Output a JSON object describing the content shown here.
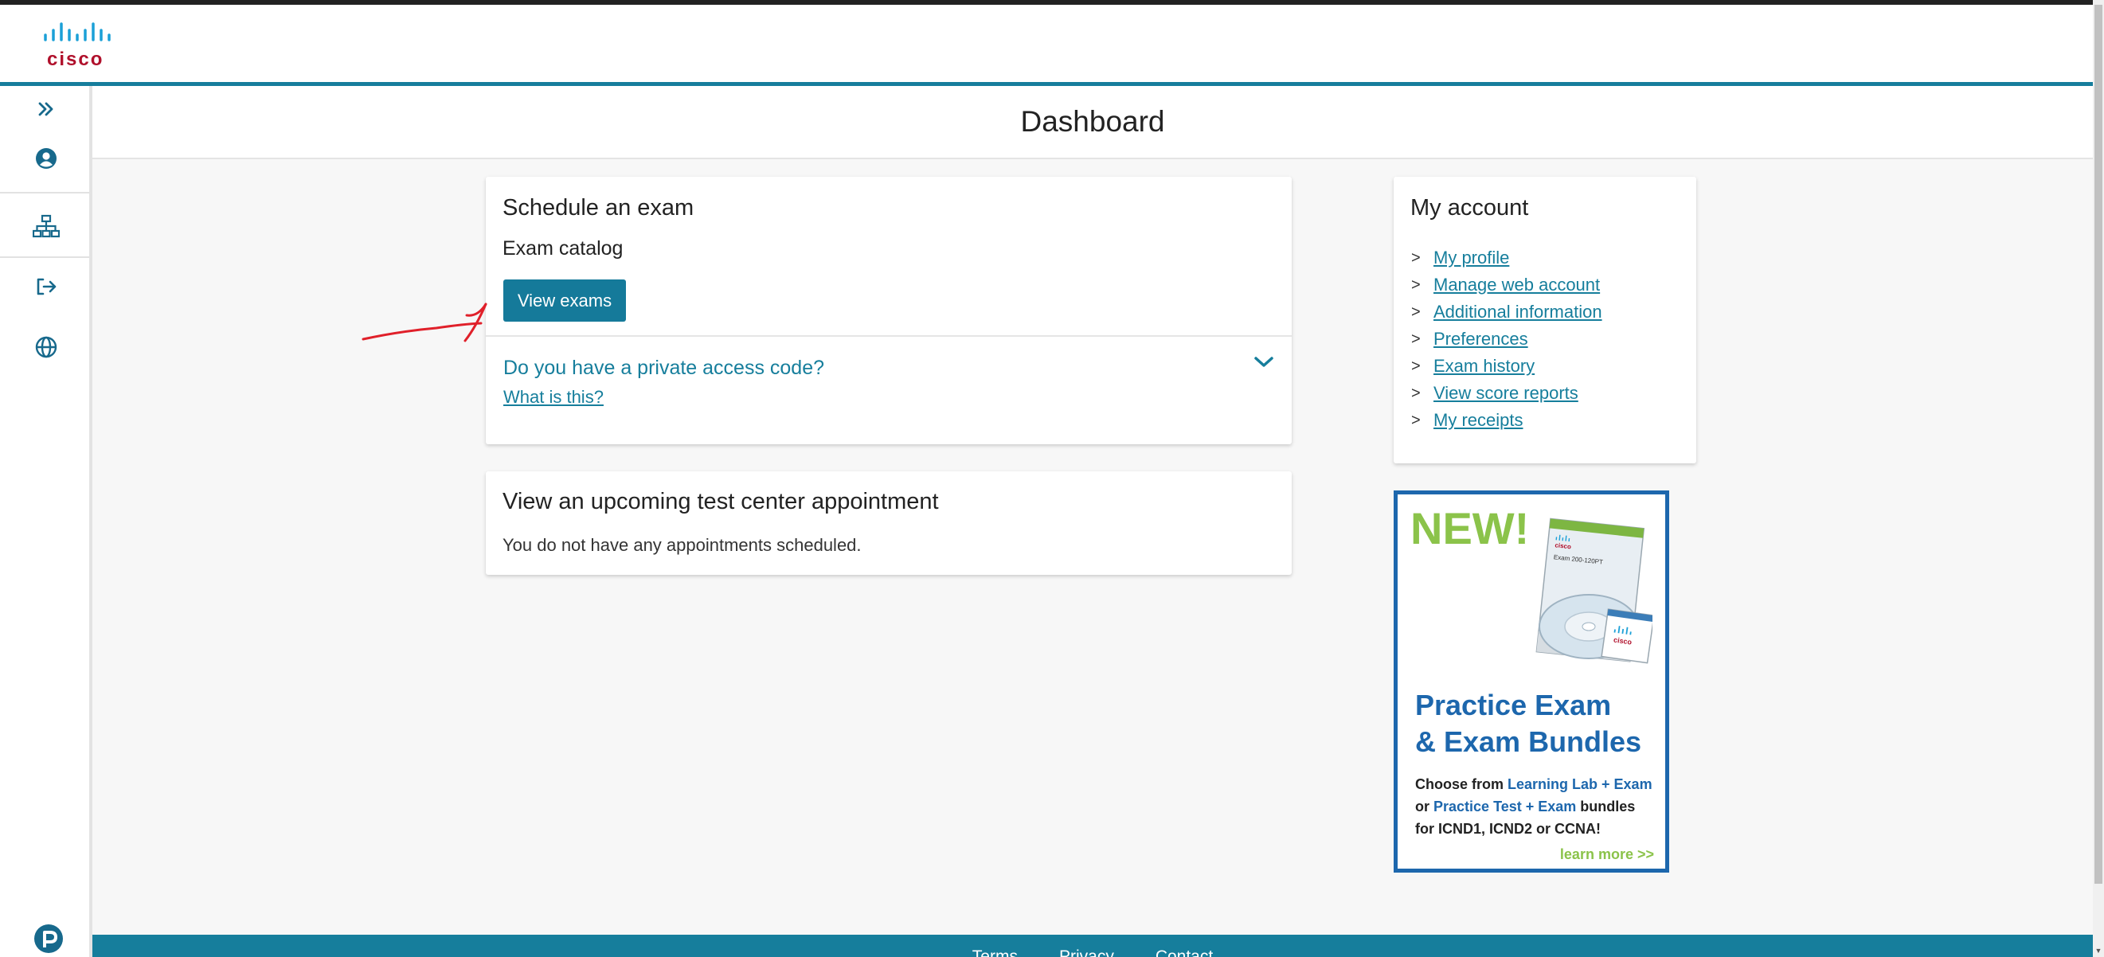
{
  "header": {
    "logo_text": "cisco"
  },
  "sidebar": {
    "items": [
      {
        "name": "expand",
        "icon": "double-chevron-right-icon"
      },
      {
        "name": "account",
        "icon": "user-circle-icon"
      },
      {
        "name": "org-chart",
        "icon": "sitemap-icon"
      },
      {
        "name": "sign-out",
        "icon": "sign-out-icon"
      },
      {
        "name": "language",
        "icon": "globe-icon"
      }
    ],
    "bottom_icon": "pearson-logo-icon"
  },
  "page": {
    "title": "Dashboard"
  },
  "schedule": {
    "heading": "Schedule an exam",
    "subheading": "Exam catalog",
    "button_label": "View exams",
    "access_question": "Do you have a private access code?",
    "what_link": "What is this?"
  },
  "appointments": {
    "heading": "View an upcoming test center appointment",
    "message": "You do not have any appointments scheduled."
  },
  "account": {
    "heading": "My account",
    "links": [
      {
        "label": "My profile"
      },
      {
        "label": "Manage web account"
      },
      {
        "label": "Additional information"
      },
      {
        "label": "Preferences"
      },
      {
        "label": "Exam history"
      },
      {
        "label": "View score reports"
      },
      {
        "label": "My receipts"
      }
    ]
  },
  "ad": {
    "badge": "NEW!",
    "book_logo": "cisco",
    "book_label": "Exam 200-120PT",
    "disc_logo": "cisco",
    "headline_1": "Practice Exam",
    "headline_2": "& Exam Bundles",
    "line1_a": "Choose from ",
    "line1_b": "Learning Lab + Exam",
    "line2_a": "or ",
    "line2_b": "Practice Test + Exam",
    "line2_c": " bundles",
    "line3": "for ICND1, ICND2 or CCNA!",
    "cta": "learn more >>"
  },
  "footer": {
    "links": [
      "Terms",
      "Privacy",
      "Contact"
    ]
  },
  "colors": {
    "brand_teal": "#167e9c",
    "cisco_red": "#b0102b",
    "ad_blue": "#1d67ad",
    "ad_green": "#8bc34a",
    "annotation_red": "#e0202a"
  }
}
